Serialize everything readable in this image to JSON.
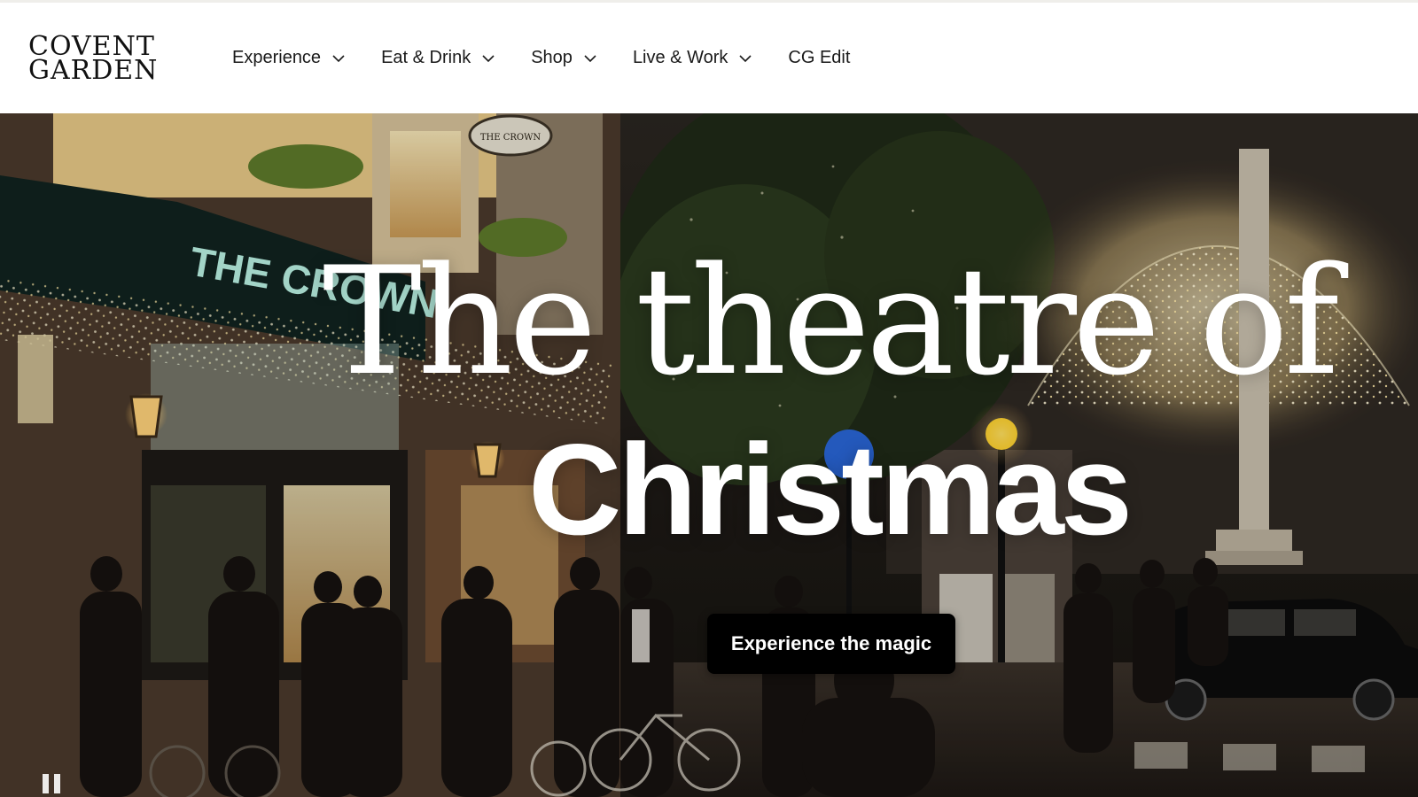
{
  "brand": {
    "logo_line1": "Covent",
    "logo_line2": "Garden"
  },
  "nav": {
    "items": [
      {
        "label": "Experience",
        "has_dropdown": true
      },
      {
        "label": "Eat & Drink",
        "has_dropdown": true
      },
      {
        "label": "Shop",
        "has_dropdown": true
      },
      {
        "label": "Live & Work",
        "has_dropdown": true
      },
      {
        "label": "CG Edit",
        "has_dropdown": false
      }
    ]
  },
  "hero": {
    "title_line1": "The theatre of",
    "title_line2": "Christmas",
    "cta_label": "Experience the magic",
    "pub_sign": "THE CROWN",
    "hanging_sign": "THE CROWN"
  },
  "colors": {
    "header_bg": "#ffffff",
    "text_dark": "#1a1a1a",
    "cta_bg": "#000000",
    "cta_text": "#ffffff",
    "hero_text": "#ffffff",
    "sign_green": "#b9f2e3"
  },
  "icons": {
    "dropdown": "chevron-down-icon",
    "media_control": "pause-icon"
  }
}
